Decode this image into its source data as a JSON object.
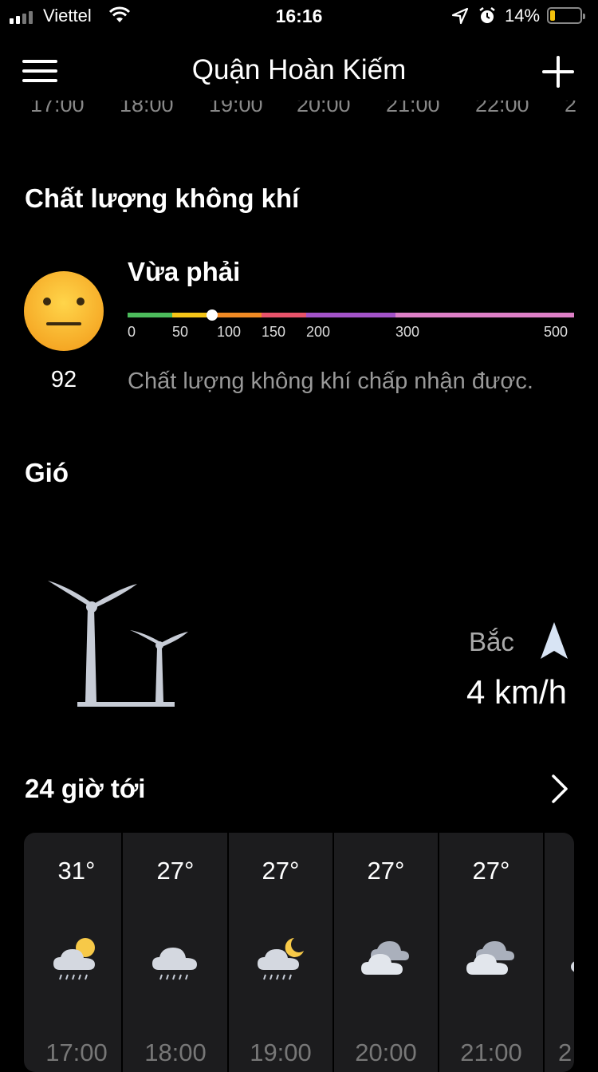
{
  "status_bar": {
    "carrier": "Viettel",
    "time": "16:16",
    "battery_percent": "14%",
    "battery_level": 0.14,
    "icons": [
      "signal-icon",
      "wifi-icon",
      "location-arrow-icon",
      "alarm-icon",
      "battery-icon"
    ]
  },
  "header": {
    "title": "Quận Hoàn Kiếm",
    "menu_icon": "hamburger-menu-icon",
    "add_icon": "plus-icon"
  },
  "prev_hours_cut": [
    "17:00",
    "18:00",
    "19:00",
    "20:00",
    "21:00",
    "22:00",
    "2"
  ],
  "air_quality": {
    "title": "Chất lượng không khí",
    "status": "Vừa phải",
    "value": "92",
    "value_numeric": 92,
    "description": "Chất lượng không khí chấp nhận được.",
    "scale_labels": [
      "0",
      "50",
      "100",
      "150",
      "200",
      "300",
      "500"
    ],
    "scale_colors": [
      "#4cbc5c",
      "#f5c518",
      "#f08a24",
      "#e8536b",
      "#a353c8",
      "#dd7fc6"
    ],
    "face_icon": "neutral-face-icon",
    "face_color": "#f7b733"
  },
  "wind": {
    "title": "Gió",
    "direction": "Bắc",
    "speed": "4 km/h",
    "turbine_icon": "wind-turbine-icon",
    "direction_icon": "navigation-arrow-icon",
    "arrow_color": "#d8e4f4"
  },
  "next24": {
    "title": "24 giờ tới",
    "chevron_icon": "chevron-right-icon",
    "hours": [
      {
        "temp": "31°",
        "icon": "partly-sunny-rain-icon",
        "time": "17:00"
      },
      {
        "temp": "27°",
        "icon": "cloud-rain-icon",
        "time": "18:00"
      },
      {
        "temp": "27°",
        "icon": "partly-moon-rain-icon",
        "time": "19:00"
      },
      {
        "temp": "27°",
        "icon": "cloudy-icon",
        "time": "20:00"
      },
      {
        "temp": "27°",
        "icon": "cloudy-icon",
        "time": "21:00"
      },
      {
        "temp": "",
        "icon": "cloudy-icon",
        "time": "2"
      }
    ]
  }
}
